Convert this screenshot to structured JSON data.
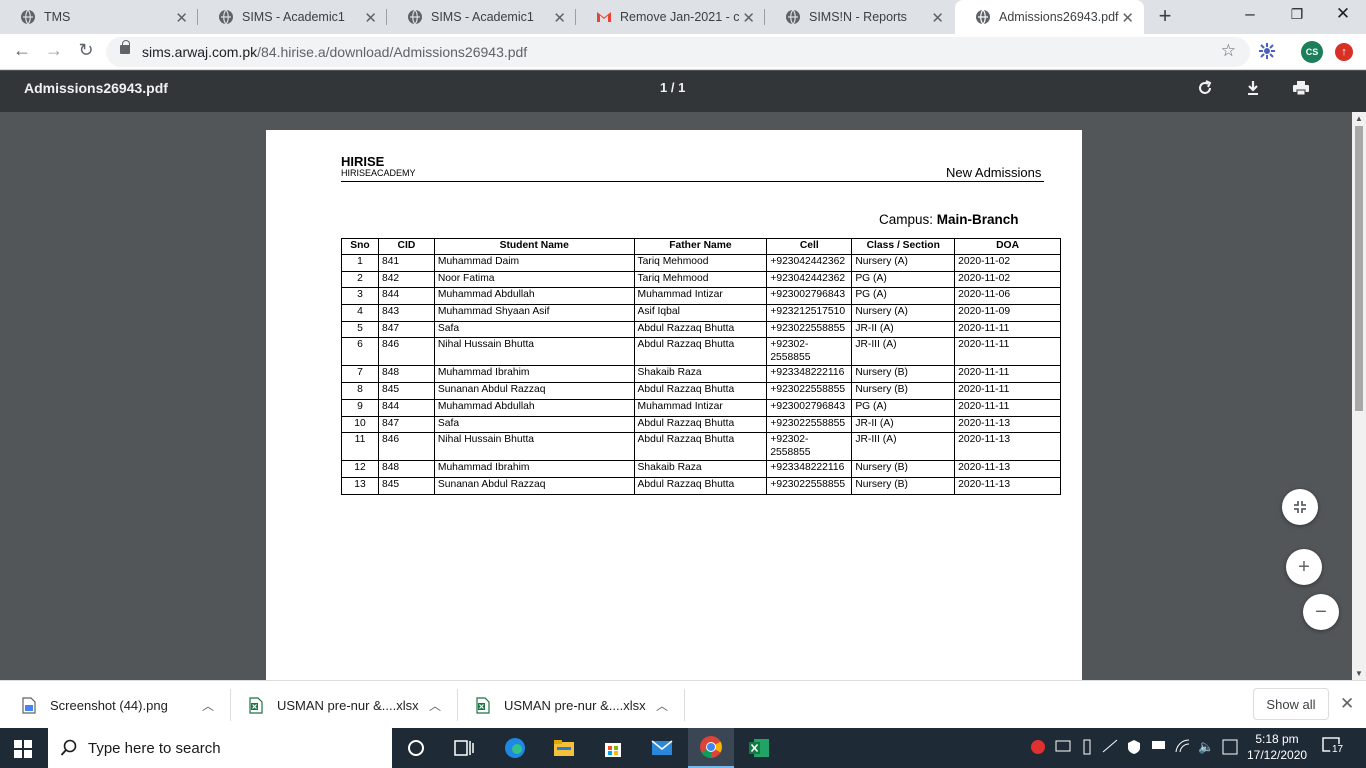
{
  "browser": {
    "tabs": [
      {
        "title": "TMS",
        "icon": "globe-icon"
      },
      {
        "title": "SIMS - Academic1",
        "icon": "globe-icon"
      },
      {
        "title": "SIMS - Academic1",
        "icon": "globe-icon"
      },
      {
        "title": "Remove Jan-2021 - cs.a",
        "icon": "gmail-icon"
      },
      {
        "title": "SIMS!N - Reports",
        "icon": "globe-icon"
      },
      {
        "title": "Admissions26943.pdf",
        "icon": "globe-icon",
        "active": true
      }
    ],
    "url_host": "sims.arwaj.com.pk",
    "url_path": "/84.hirise.a/download/Admissions26943.pdf",
    "profile_initials": "CS"
  },
  "pdf_viewer": {
    "file_name": "Admissions26943.pdf",
    "page_indicator": "1 / 1"
  },
  "document": {
    "school_name": "HIRISE",
    "school_subtitle": "HIRISEACADEMY",
    "report_title": "New Admissions",
    "campus_label": "Campus:",
    "campus_value": "Main-Branch",
    "columns": [
      "Sno",
      "CID",
      "Student Name",
      "Father Name",
      "Cell",
      "Class / Section",
      "DOA"
    ],
    "rows": [
      [
        "1",
        "841",
        "Muhammad Daim",
        "Tariq Mehmood",
        "+923042442362",
        "Nursery (A)",
        "2020-11-02"
      ],
      [
        "2",
        "842",
        "Noor Fatima",
        "Tariq Mehmood",
        "+923042442362",
        "PG (A)",
        "2020-11-02"
      ],
      [
        "3",
        "844",
        "Muhammad Abdullah",
        "Muhammad Intizar",
        "+923002796843",
        "PG (A)",
        "2020-11-06"
      ],
      [
        "4",
        "843",
        "Muhammad Shyaan Asif",
        "Asif Iqbal",
        "+923212517510",
        "Nursery (A)",
        "2020-11-09"
      ],
      [
        "5",
        "847",
        "Safa",
        "Abdul Razzaq Bhutta",
        "+923022558855",
        "JR-II (A)",
        "2020-11-11"
      ],
      [
        "6",
        "846",
        "Nihal Hussain Bhutta",
        "Abdul Razzaq Bhutta",
        "+92302-2558855",
        "JR-III (A)",
        "2020-11-11"
      ],
      [
        "7",
        "848",
        "Muhammad Ibrahim",
        "Shakaib Raza",
        "+923348222116",
        "Nursery (B)",
        "2020-11-11"
      ],
      [
        "8",
        "845",
        "Sunanan Abdul Razzaq",
        "Abdul Razzaq Bhutta",
        "+923022558855",
        "Nursery (B)",
        "2020-11-11"
      ],
      [
        "9",
        "844",
        "Muhammad Abdullah",
        "Muhammad Intizar",
        "+923002796843",
        "PG (A)",
        "2020-11-11"
      ],
      [
        "10",
        "847",
        "Safa",
        "Abdul Razzaq Bhutta",
        "+923022558855",
        "JR-II (A)",
        "2020-11-13"
      ],
      [
        "11",
        "846",
        "Nihal Hussain Bhutta",
        "Abdul Razzaq Bhutta",
        "+92302-2558855",
        "JR-III (A)",
        "2020-11-13"
      ],
      [
        "12",
        "848",
        "Muhammad Ibrahim",
        "Shakaib Raza",
        "+923348222116",
        "Nursery (B)",
        "2020-11-13"
      ],
      [
        "13",
        "845",
        "Sunanan Abdul Razzaq",
        "Abdul Razzaq Bhutta",
        "+923022558855",
        "Nursery (B)",
        "2020-11-13"
      ]
    ]
  },
  "downloads": {
    "items": [
      {
        "name": "Screenshot (44).png",
        "icon": "image-file-icon"
      },
      {
        "name": "USMAN pre-nur &....xlsx",
        "icon": "excel-file-icon"
      },
      {
        "name": "USMAN pre-nur &....xlsx",
        "icon": "excel-file-icon"
      }
    ],
    "show_all": "Show all"
  },
  "taskbar": {
    "search_placeholder": "Type here to search",
    "time": "5:18 pm",
    "date": "17/12/2020",
    "notification_count": "17"
  },
  "colors": {
    "pdf_toolbar": "#323639",
    "viewer_bg": "#525659",
    "tabstrip": "#dee1e6",
    "taskbar": "#1f2a37"
  }
}
